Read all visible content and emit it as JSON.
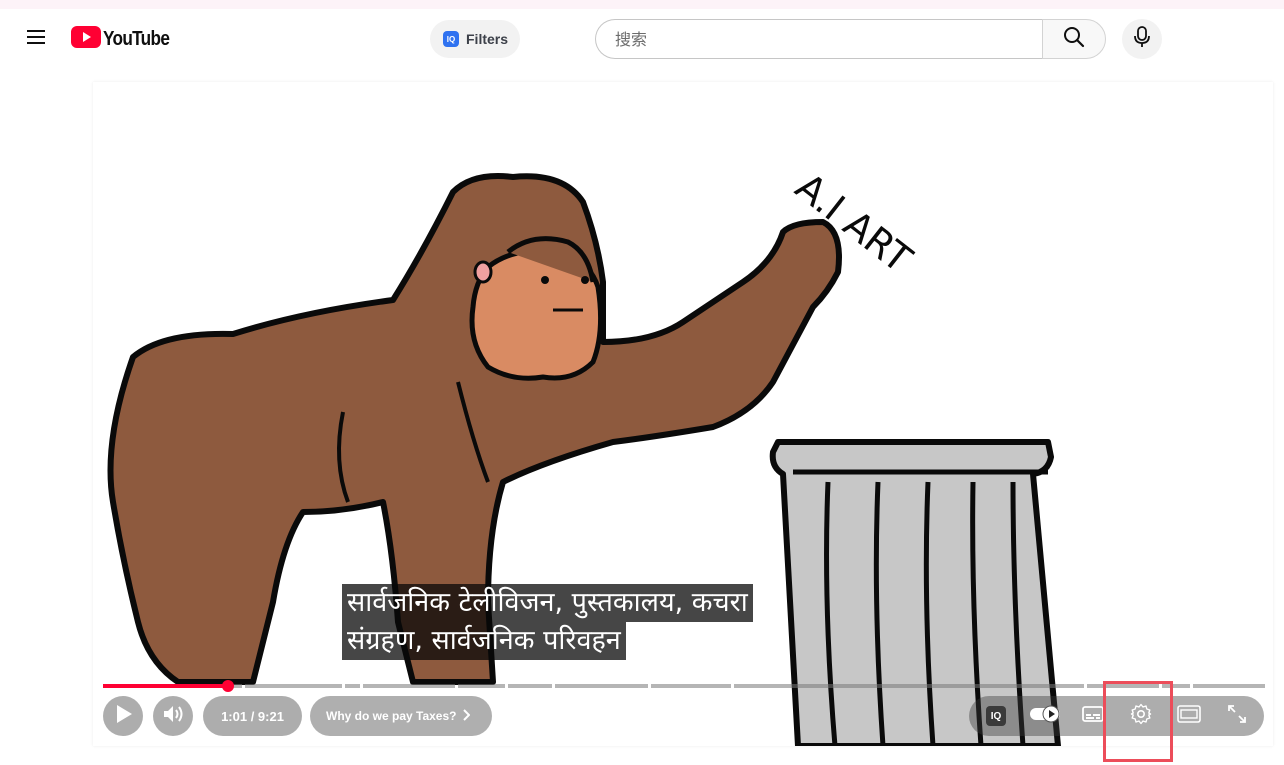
{
  "masthead": {
    "logo_text": "YouTube",
    "filters_label": "Filters",
    "filters_badge": "IQ",
    "search_placeholder": "搜索"
  },
  "player": {
    "art_text": "A.I ART",
    "captions": [
      "सार्वजनिक टेलीविजन, पुस्तकालय, कचरा",
      "संग्रहण, सार्वजनिक परिवहन"
    ],
    "progress_fraction": 0.108,
    "time_display": "1:01 / 9:21",
    "chapter_title": "Why do we pay Taxes?",
    "iq_badge": "IQ"
  },
  "colors": {
    "brand_red": "#ff0033",
    "highlight": "#ec4d5a"
  },
  "icons": {
    "menu": "hamburger-icon",
    "search": "search-icon",
    "mic": "microphone-icon",
    "play": "play-icon",
    "volume": "volume-icon",
    "autoplay": "autoplay-toggle-icon",
    "subtitles": "subtitles-icon",
    "settings": "gear-icon",
    "miniplayer": "miniplayer-icon",
    "fullscreen": "fullscreen-icon"
  }
}
